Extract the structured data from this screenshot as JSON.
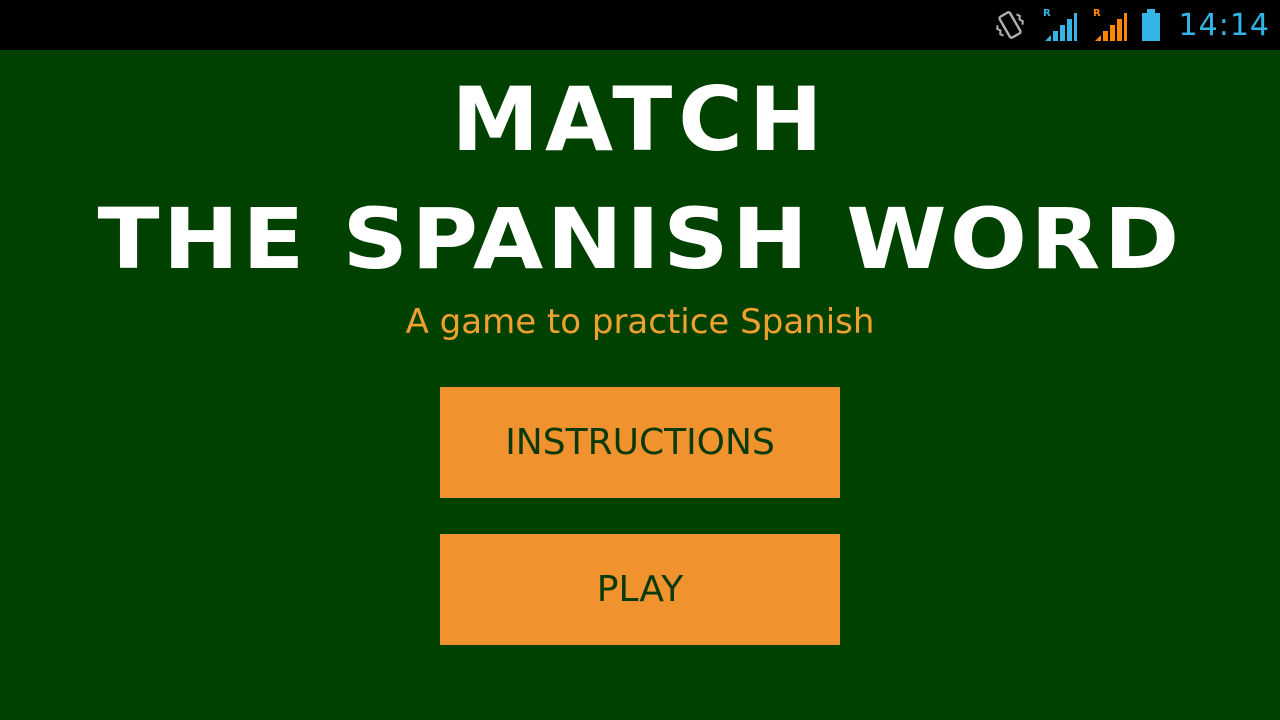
{
  "status_bar": {
    "time": "14:14",
    "icons": [
      "vibrate-icon",
      "signal-roaming-icon",
      "signal-roaming-icon",
      "battery-icon"
    ],
    "roaming_label": "R",
    "colors": {
      "primary_signal": "#33b5e5",
      "secondary_signal": "#ff8800",
      "battery": "#33b5e5"
    }
  },
  "app": {
    "title_line1": "MATCH",
    "title_line2": "THE SPANISH WORD",
    "subtitle": "A game to practice Spanish",
    "buttons": {
      "instructions_label": "INSTRUCTIONS",
      "play_label": "PLAY"
    },
    "colors": {
      "background": "#004100",
      "button": "#f0922d",
      "button_text": "#0a3a0a",
      "subtitle": "#f0a030",
      "title": "#ffffff"
    }
  }
}
